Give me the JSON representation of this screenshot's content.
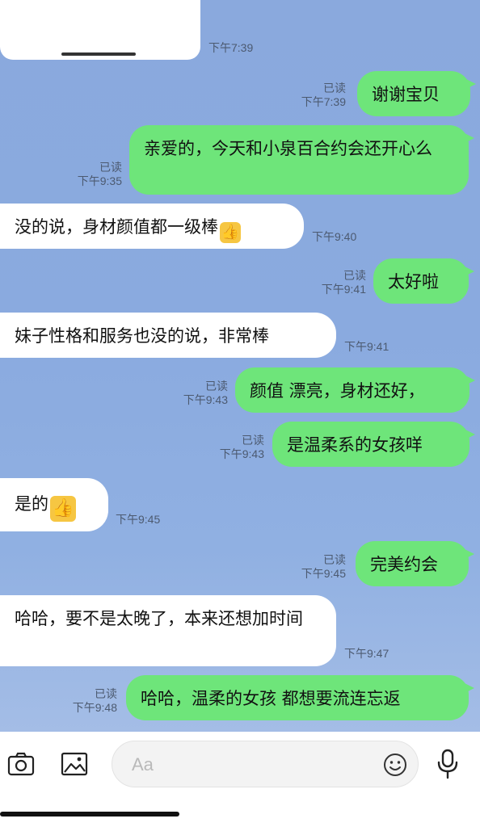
{
  "top_card": {
    "time": "下午7:39"
  },
  "messages": [
    {
      "side": "out",
      "text": "谢谢宝贝",
      "read": "已读",
      "time": "下午7:39"
    },
    {
      "side": "out",
      "text": "亲爱的，今天和小泉百合约会还开心么",
      "read": "已读",
      "time": "下午9:35"
    },
    {
      "side": "in",
      "text": "没的说，身材颜值都一级棒",
      "icon": "thumbs-up-icon",
      "time": "下午9:40"
    },
    {
      "side": "out",
      "text": "太好啦",
      "read": "已读",
      "time": "下午9:41"
    },
    {
      "side": "in",
      "text": "妹子性格和服务也没的说，非常棒",
      "time": "下午9:41"
    },
    {
      "side": "out",
      "text": "颜值 漂亮，身材还好，",
      "read": "已读",
      "time": "下午9:43"
    },
    {
      "side": "out",
      "text": "是温柔系的女孩咩",
      "read": "已读",
      "time": "下午9:43"
    },
    {
      "side": "in",
      "text": "是的",
      "icon": "thumbs-up-icon",
      "time": "下午9:45"
    },
    {
      "side": "out",
      "text": "完美约会",
      "read": "已读",
      "time": "下午9:45"
    },
    {
      "side": "in",
      "text": "哈哈，要不是太晚了，本来还想加时间",
      "time": "下午9:47"
    },
    {
      "side": "out",
      "text": "哈哈，温柔的女孩 都想要流连忘返",
      "read": "已读",
      "time": "下午9:48"
    }
  ],
  "input_bar": {
    "placeholder": "Aa",
    "icons": [
      "camera-icon",
      "image-icon",
      "emoji-icon",
      "microphone-icon"
    ]
  },
  "colors": {
    "chat_background": "#8aa9dd",
    "outgoing_bubble": "#6ee57a",
    "incoming_bubble": "#ffffff"
  }
}
